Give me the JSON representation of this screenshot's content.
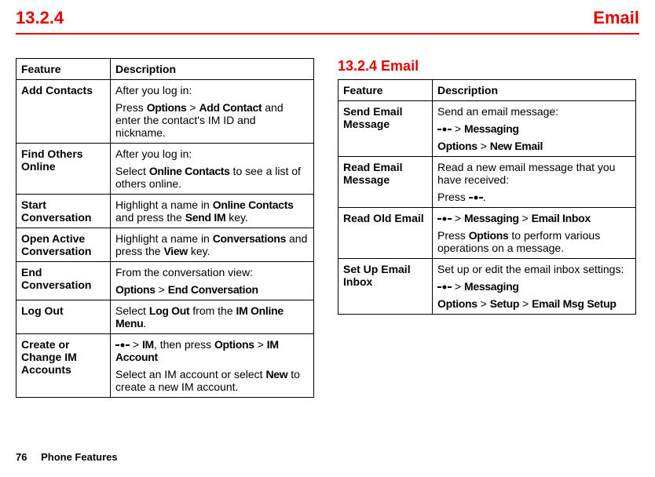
{
  "header": {
    "section_number": "13.2.4",
    "section_title": "Email"
  },
  "left_table": {
    "columns": [
      "Feature",
      "Description"
    ],
    "rows": [
      {
        "feature": "Add Contacts",
        "desc_lines": [
          {
            "parts": [
              {
                "t": "After you log in:"
              }
            ]
          },
          {
            "parts": [
              {
                "t": "Press "
              },
              {
                "t": "Options",
                "bold": true
              },
              {
                "t": " > "
              },
              {
                "t": "Add Contact",
                "bold": true
              },
              {
                "t": " and enter the contact's IM ID and nickname."
              }
            ]
          }
        ]
      },
      {
        "feature": "Find Others Online",
        "desc_lines": [
          {
            "parts": [
              {
                "t": "After you log in:"
              }
            ]
          },
          {
            "parts": [
              {
                "t": "Select "
              },
              {
                "t": "Online Contacts",
                "bold": true
              },
              {
                "t": " to see a list of others online."
              }
            ]
          }
        ]
      },
      {
        "feature": "Start Conversation",
        "desc_lines": [
          {
            "parts": [
              {
                "t": "Highlight a name in "
              },
              {
                "t": "Online Contacts",
                "bold": true
              },
              {
                "t": " and press the "
              },
              {
                "t": "Send IM",
                "bold": true
              },
              {
                "t": " key."
              }
            ]
          }
        ]
      },
      {
        "feature": "Open Active Conversation",
        "desc_lines": [
          {
            "parts": [
              {
                "t": "Highlight a name in "
              },
              {
                "t": "Conversations",
                "bold": true
              },
              {
                "t": " and press the "
              },
              {
                "t": "View",
                "bold": true
              },
              {
                "t": " key."
              }
            ]
          }
        ]
      },
      {
        "feature": "End Conversation",
        "desc_lines": [
          {
            "parts": [
              {
                "t": "From the conversation view:"
              }
            ]
          },
          {
            "parts": [
              {
                "t": "Options",
                "bold": true
              },
              {
                "t": " > "
              },
              {
                "t": "End Conversation",
                "bold": true
              }
            ]
          }
        ]
      },
      {
        "feature": "Log Out",
        "desc_lines": [
          {
            "parts": [
              {
                "t": "Select "
              },
              {
                "t": "Log Out",
                "bold": true
              },
              {
                "t": " from the "
              },
              {
                "t": "IM Online Menu",
                "bold": true
              },
              {
                "t": "."
              }
            ]
          }
        ]
      },
      {
        "feature": "Create or Change IM Accounts",
        "desc_lines": [
          {
            "parts": [
              {
                "icon": "center-key"
              },
              {
                "t": " > "
              },
              {
                "t": "IM",
                "bold": true
              },
              {
                "t": ", then press "
              },
              {
                "t": "Options",
                "bold": true
              },
              {
                "t": " > "
              },
              {
                "t": "IM Account",
                "bold": true
              }
            ]
          },
          {
            "parts": [
              {
                "t": "Select an IM account or select "
              },
              {
                "t": "New",
                "bold": true
              },
              {
                "t": " to create a new IM account."
              }
            ]
          }
        ]
      }
    ]
  },
  "right_heading": "13.2.4 Email",
  "right_table": {
    "columns": [
      "Feature",
      "Description"
    ],
    "rows": [
      {
        "feature": "Send Email Message",
        "desc_lines": [
          {
            "parts": [
              {
                "t": "Send an email message:"
              }
            ]
          },
          {
            "parts": [
              {
                "icon": "center-key"
              },
              {
                "t": " > "
              },
              {
                "t": "Messaging",
                "bold": true
              }
            ]
          },
          {
            "parts": [
              {
                "t": "Options",
                "bold": true
              },
              {
                "t": " > "
              },
              {
                "t": "New Email",
                "bold": true
              }
            ]
          }
        ]
      },
      {
        "feature": "Read Email Message",
        "desc_lines": [
          {
            "parts": [
              {
                "t": "Read a new email message that you have received:"
              }
            ]
          },
          {
            "parts": [
              {
                "t": "Press "
              },
              {
                "icon": "center-key"
              },
              {
                "t": "."
              }
            ]
          }
        ]
      },
      {
        "feature": "Read Old Email",
        "desc_lines": [
          {
            "parts": [
              {
                "icon": "center-key"
              },
              {
                "t": " > "
              },
              {
                "t": "Messaging",
                "bold": true
              },
              {
                "t": " > "
              },
              {
                "t": "Email Inbox",
                "bold": true
              }
            ]
          },
          {
            "parts": [
              {
                "t": "Press "
              },
              {
                "t": "Options",
                "bold": true
              },
              {
                "t": " to perform various operations on a message."
              }
            ]
          }
        ]
      },
      {
        "feature": "Set Up Email Inbox",
        "desc_lines": [
          {
            "parts": [
              {
                "t": "Set up or edit the email inbox settings:"
              }
            ]
          },
          {
            "parts": [
              {
                "icon": "center-key"
              },
              {
                "t": " > "
              },
              {
                "t": "Messaging",
                "bold": true
              }
            ]
          },
          {
            "parts": [
              {
                "t": "Options",
                "bold": true
              },
              {
                "t": " > "
              },
              {
                "t": "Setup",
                "bold": true
              },
              {
                "t": " > "
              },
              {
                "t": "Email Msg Setup",
                "bold": true
              }
            ]
          }
        ]
      }
    ]
  },
  "footer": {
    "page_number": "76",
    "chapter_title": "Phone Features"
  }
}
